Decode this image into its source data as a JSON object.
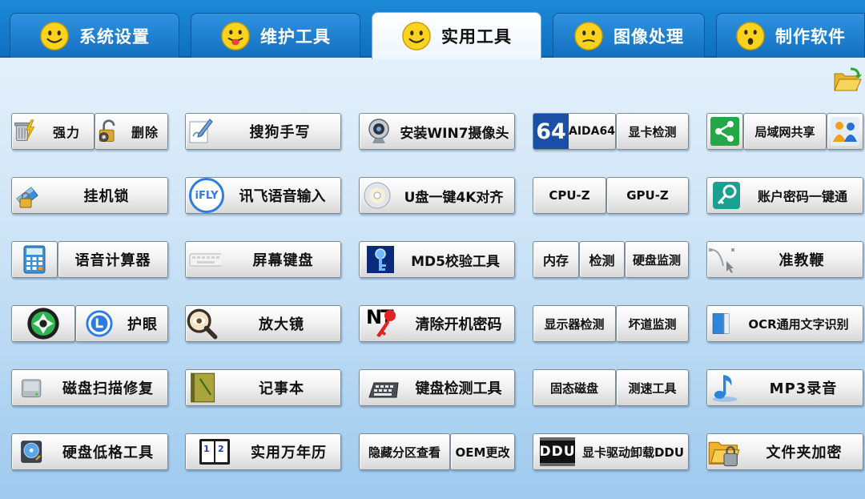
{
  "tabs": [
    {
      "label": "系统设置",
      "active": false
    },
    {
      "label": "维护工具",
      "active": false
    },
    {
      "label": "实用工具",
      "active": true
    },
    {
      "label": "图像处理",
      "active": false
    },
    {
      "label": "制作软件",
      "active": false
    }
  ],
  "buttons": {
    "force": "强力",
    "delete": "删除",
    "sogou_handwriting": "搜狗手写",
    "install_win7_camera": "安装WIN7摄像头",
    "aida64": "AIDA64",
    "aida64_icon_text": "64",
    "gpu_check": "显卡检测",
    "lan_share": "局域网共享",
    "hang_lock": "挂机锁",
    "ifly_voice_input": "讯飞语音输入",
    "ifly_logo_text": "iFLY",
    "usb_4k_align": "U盘一键4K对齐",
    "cpu_z": "CPU-Z",
    "gpu_z": "GPU-Z",
    "account_password": "账户密码一键通",
    "voice_calculator": "语音计算器",
    "screen_keyboard": "屏幕键盘",
    "md5_tool": "MD5校验工具",
    "memory": "内存",
    "check": "检测",
    "disk_monitor": "硬盘监测",
    "cursor_tool": "准教鞭",
    "eye_protect": "护眼",
    "magnifier": "放大镜",
    "clear_boot_password": "清除开机密码",
    "nt_text": "NT",
    "monitor_check": "显示器检测",
    "bad_sector_monitor": "坏道监测",
    "ocr": "OCR通用文字识别",
    "disk_scan_repair": "磁盘扫描修复",
    "notepad": "记事本",
    "keyboard_test": "键盘检测工具",
    "ssd": "固态磁盘",
    "speed_test": "测速工具",
    "mp3_record": "MP3录音",
    "low_format": "硬盘低格工具",
    "calendar": "实用万年历",
    "hidden_partition": "隐藏分区查看",
    "oem_change": "OEM更改",
    "ddu": "显卡驱动卸载DDU",
    "ddu_logo": "DDU",
    "folder_encrypt": "文件夹加密"
  },
  "colors": {
    "tabbar": "#1478cc",
    "active_tab": "#ffffff",
    "background_top": "#eaf4fc",
    "background_bottom": "#9ecaee",
    "button_face": "#f2f2f2"
  }
}
